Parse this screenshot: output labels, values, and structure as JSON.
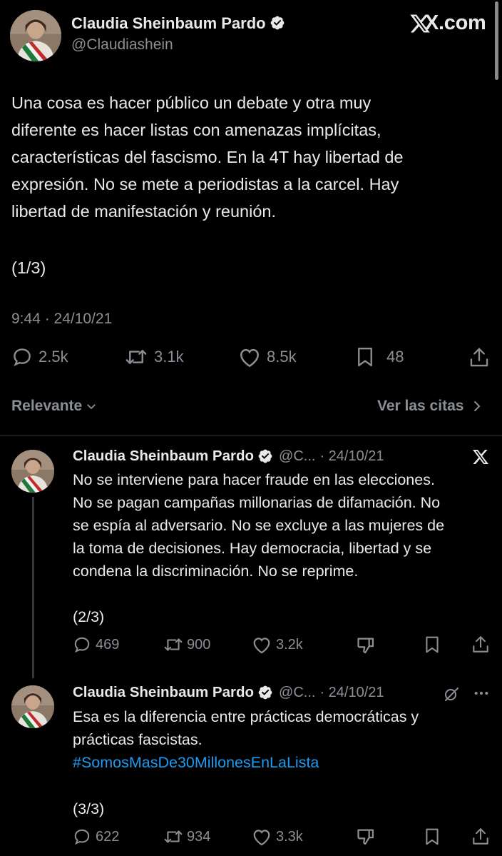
{
  "brand": "X.com",
  "main_tweet": {
    "author": "Claudia Sheinbaum Pardo",
    "handle": "@Claudiashein",
    "lines": [
      "Una cosa es hacer público un debate y otra muy",
      "diferente es hacer listas con amenazas implícitas,",
      "características del fascismo. En la 4T hay  libertad de",
      "expresión. No se mete a periodistas a la carcel. Hay",
      "libertad de manifestación y reunión."
    ],
    "thread_marker": "(1/3)",
    "timestamp": "9:44 · 24/10/21",
    "replies": "2.5k",
    "reposts": "3.1k",
    "likes": "8.5k",
    "bookmarks": "48"
  },
  "sort": {
    "label": "Relevante",
    "quotes_link": "Ver las citas"
  },
  "reply_2": {
    "author": "Claudia Sheinbaum Pardo",
    "handle": "@C...",
    "date": "· 24/10/21",
    "lines": [
      "No se interviene para hacer fraude en las elecciones.",
      "No se pagan campañas millonarias de difamación. No",
      "se espía al adversario. No se excluye a las mujeres de",
      "la toma de decisiones. Hay democracia, libertad y se",
      "condena la discriminación. No se reprime."
    ],
    "thread_marker": "(2/3)",
    "replies": "469",
    "reposts": "900",
    "likes": "3.2k"
  },
  "reply_3": {
    "author": "Claudia Sheinbaum Pardo",
    "handle": "@C...",
    "date": "· 24/10/21",
    "line1": "Esa es la diferencia entre prácticas democráticas y",
    "line2": "prácticas fascistas.",
    "hashtag": "#SomosMasDe30MillonesEnLaLista",
    "thread_marker": "(3/3)",
    "replies": "622",
    "reposts": "934",
    "likes": "3.3k"
  },
  "colors": {
    "background": "#000000",
    "text": "#e7e9ea",
    "muted": "#8b8f94",
    "accent": "#1d9bf0",
    "divider": "#2f3336"
  },
  "icons": [
    "verified-badge-icon",
    "x-logo-icon",
    "reply-icon",
    "repost-icon",
    "like-icon",
    "bookmark-icon",
    "share-icon",
    "downvote-icon",
    "more-icon",
    "grok-icon",
    "chevron-down-icon",
    "chevron-right-icon"
  ]
}
